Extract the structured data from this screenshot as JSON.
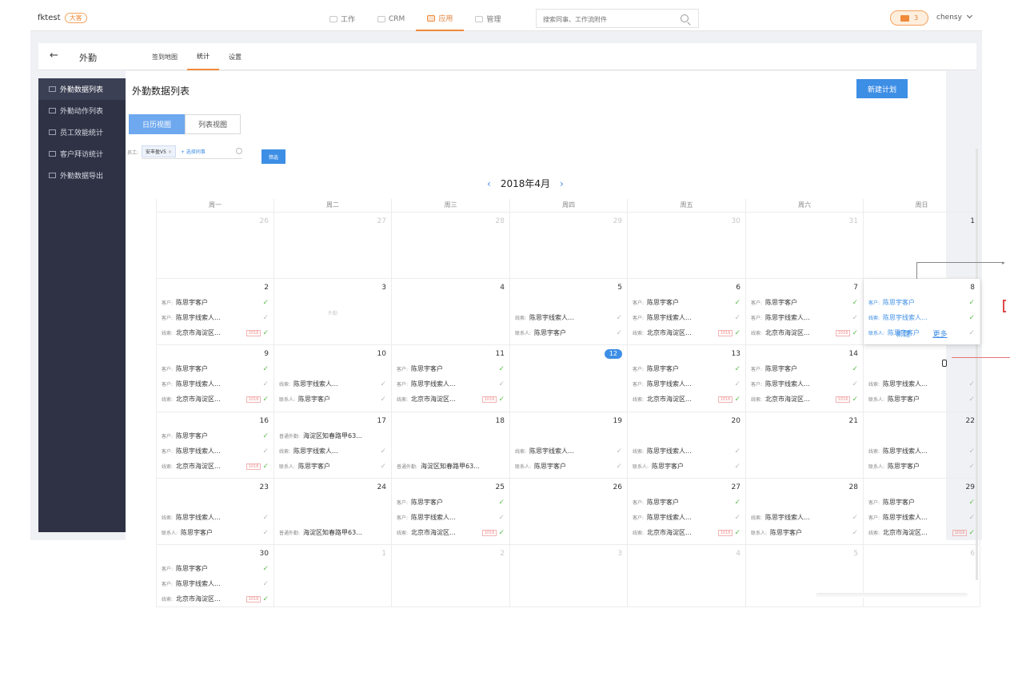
{
  "app": {
    "brand": "fktest",
    "brand_badge": "大客",
    "nav": [
      {
        "label": "工作",
        "active": false
      },
      {
        "label": "CRM",
        "active": false
      },
      {
        "label": "应用",
        "active": true
      },
      {
        "label": "管理",
        "active": false
      }
    ],
    "search_placeholder": "搜索同事、工作流附件",
    "message_count": "3",
    "user": "chensy"
  },
  "subbar": {
    "back_icon": "←",
    "title": "外勤",
    "tabs": [
      {
        "label": "签到地图",
        "active": false
      },
      {
        "label": "统计",
        "active": true
      },
      {
        "label": "设置",
        "active": false
      }
    ]
  },
  "sidebar": {
    "items": [
      {
        "label": "外勤数据列表",
        "active": true
      },
      {
        "label": "外勤动作列表",
        "active": false
      },
      {
        "label": "员工效能统计",
        "active": false
      },
      {
        "label": "客户拜访统计",
        "active": false
      },
      {
        "label": "外勤数据导出",
        "active": false
      }
    ]
  },
  "main": {
    "title": "外勤数据列表",
    "new_button": "新建计划",
    "view_tabs": [
      {
        "label": "日历视图",
        "active": true
      },
      {
        "label": "列表视图",
        "active": false
      }
    ],
    "filter_label": "员工:",
    "filter_chip": "安丰盈V5",
    "filter_chip_close": "×",
    "filter_add": "+ 选择同事",
    "filter_button": "筛选",
    "month": "2018年4月",
    "prev": "‹",
    "next": "›"
  },
  "colors": {
    "accent": "#f08a3a",
    "primary": "#3d8ee5",
    "sidebar": "#2f3245",
    "check": "#5cbd4c"
  },
  "calendar": {
    "weekdays": [
      "周一",
      "周二",
      "周三",
      "周四",
      "周五",
      "周六",
      "周日"
    ],
    "weeks": [
      {
        "height": 83,
        "days": [
          {
            "day": "26",
            "muted": true,
            "events": []
          },
          {
            "day": "27",
            "muted": true,
            "events": []
          },
          {
            "day": "28",
            "muted": true,
            "events": []
          },
          {
            "day": "29",
            "muted": true,
            "events": []
          },
          {
            "day": "30",
            "muted": true,
            "events": []
          },
          {
            "day": "31",
            "muted": true,
            "events": []
          },
          {
            "day": "1",
            "muted": false,
            "events": []
          }
        ]
      },
      {
        "height": 83,
        "days": [
          {
            "day": "2",
            "events": [
              {
                "label": "客户:",
                "text": "陈思宇客户",
                "done": true
              },
              {
                "label": "客户:",
                "text": "陈思宇线索人...",
                "done": false
              },
              {
                "label": "线索:",
                "text": "北京市海淀区...",
                "tag": "1016",
                "done": true
              }
            ]
          },
          {
            "day": "3",
            "events": [],
            "faint": "外勤"
          },
          {
            "day": "4",
            "events": []
          },
          {
            "day": "5",
            "pad": 1,
            "events": [
              {
                "label": "线索:",
                "text": "陈思宇线索人...",
                "done": false
              },
              {
                "label": "联系人:",
                "text": "陈思宇客户",
                "done": false
              }
            ]
          },
          {
            "day": "6",
            "events": [
              {
                "label": "客户:",
                "text": "陈思宇客户",
                "done": true
              },
              {
                "label": "客户:",
                "text": "陈思宇线索人...",
                "done": false
              },
              {
                "label": "线索:",
                "text": "北京市海淀区...",
                "tag": "1016",
                "done": true
              }
            ]
          },
          {
            "day": "7",
            "events": [
              {
                "label": "客户:",
                "text": "陈思宇客户",
                "done": true
              },
              {
                "label": "客户:",
                "text": "陈思宇线索人...",
                "done": false
              },
              {
                "label": "线索:",
                "text": "北京市海淀区...",
                "tag": "1016",
                "done": true
              }
            ]
          },
          {
            "day": "8",
            "popup": true,
            "events": [
              {
                "label": "客户:",
                "text": "陈思宇客户",
                "done": true,
                "blue": true
              },
              {
                "label": "线索:",
                "text": "陈思宇线索人...",
                "done": true,
                "blue": true
              },
              {
                "label": "联系人:",
                "text": "陈思宇客户",
                "done": false,
                "blue": true
              }
            ]
          }
        ]
      },
      {
        "height": 84,
        "days": [
          {
            "day": "9",
            "events": [
              {
                "label": "客户:",
                "text": "陈思宇客户",
                "done": true
              },
              {
                "label": "客户:",
                "text": "陈思宇线索人...",
                "done": false
              },
              {
                "label": "线索:",
                "text": "北京市海淀区...",
                "tag": "1016",
                "done": true
              }
            ]
          },
          {
            "day": "10",
            "pad": 1,
            "events": [
              {
                "label": "线索:",
                "text": "陈思宇线索人...",
                "done": false
              },
              {
                "label": "联系人:",
                "text": "陈思宇客户",
                "done": false
              }
            ]
          },
          {
            "day": "11",
            "events": [
              {
                "label": "客户:",
                "text": "陈思宇客户",
                "done": true
              },
              {
                "label": "客户:",
                "text": "陈思宇线索人...",
                "done": false
              },
              {
                "label": "线索:",
                "text": "北京市海淀区...",
                "tag": "1016",
                "done": true
              }
            ]
          },
          {
            "day": "12",
            "today": true,
            "events": []
          },
          {
            "day": "13",
            "events": [
              {
                "label": "客户:",
                "text": "陈思宇客户",
                "done": true
              },
              {
                "label": "客户:",
                "text": "陈思宇线索人...",
                "done": false
              },
              {
                "label": "线索:",
                "text": "北京市海淀区...",
                "tag": "1016",
                "done": true
              }
            ]
          },
          {
            "day": "14",
            "events": [
              {
                "label": "客户:",
                "text": "陈思宇客户",
                "done": true
              },
              {
                "label": "客户:",
                "text": "陈思宇线索人...",
                "done": false
              },
              {
                "label": "线索:",
                "text": "北京市海淀区...",
                "tag": "1016",
                "done": true
              }
            ]
          },
          {
            "day": "",
            "pad": 1,
            "events": [
              {
                "label": "线索:",
                "text": "陈思宇线索人...",
                "done": false
              },
              {
                "label": "联系人:",
                "text": "陈思宇客户",
                "done": false
              }
            ]
          }
        ]
      },
      {
        "height": 83,
        "days": [
          {
            "day": "16",
            "events": [
              {
                "label": "客户:",
                "text": "陈思宇客户",
                "done": true
              },
              {
                "label": "客户:",
                "text": "陈思宇线索人...",
                "done": false
              },
              {
                "label": "线索:",
                "text": "北京市海淀区...",
                "tag": "1016",
                "done": true
              }
            ]
          },
          {
            "day": "17",
            "events": [
              {
                "label": "普通外勤:",
                "text": "海淀区知春路甲63...",
                "done": null
              },
              {
                "label": "线索:",
                "text": "陈思宇线索人...",
                "done": false
              },
              {
                "label": "联系人:",
                "text": "陈思宇客户",
                "done": false
              }
            ]
          },
          {
            "day": "18",
            "pad": 2,
            "events": [
              {
                "label": "普通外勤:",
                "text": "海淀区知春路甲63...",
                "done": null
              }
            ]
          },
          {
            "day": "19",
            "pad": 1,
            "events": [
              {
                "label": "线索:",
                "text": "陈思宇线索人...",
                "done": false
              },
              {
                "label": "联系人:",
                "text": "陈思宇客户",
                "done": false
              }
            ]
          },
          {
            "day": "20",
            "pad": 1,
            "events": [
              {
                "label": "线索:",
                "text": "陈思宇线索人...",
                "done": false
              },
              {
                "label": "联系人:",
                "text": "陈思宇客户",
                "done": false
              }
            ]
          },
          {
            "day": "21",
            "events": []
          },
          {
            "day": "22",
            "pad": 1,
            "events": [
              {
                "label": "线索:",
                "text": "陈思宇线索人...",
                "done": false
              },
              {
                "label": "联系人:",
                "text": "陈思宇客户",
                "done": false
              }
            ]
          }
        ]
      },
      {
        "height": 83,
        "days": [
          {
            "day": "23",
            "pad": 1,
            "events": [
              {
                "label": "线索:",
                "text": "陈思宇线索人...",
                "done": false
              },
              {
                "label": "联系人:",
                "text": "陈思宇客户",
                "done": false
              }
            ]
          },
          {
            "day": "24",
            "pad": 2,
            "events": [
              {
                "label": "普通外勤:",
                "text": "海淀区知春路甲63...",
                "done": null
              }
            ]
          },
          {
            "day": "25",
            "events": [
              {
                "label": "客户:",
                "text": "陈思宇客户",
                "done": true
              },
              {
                "label": "客户:",
                "text": "陈思宇线索人...",
                "done": false
              },
              {
                "label": "线索:",
                "text": "北京市海淀区...",
                "tag": "1016",
                "done": true
              }
            ]
          },
          {
            "day": "26",
            "events": []
          },
          {
            "day": "27",
            "events": [
              {
                "label": "客户:",
                "text": "陈思宇客户",
                "done": true
              },
              {
                "label": "客户:",
                "text": "陈思宇线索人...",
                "done": false
              },
              {
                "label": "线索:",
                "text": "北京市海淀区...",
                "tag": "1016",
                "done": true
              }
            ]
          },
          {
            "day": "28",
            "pad": 1,
            "events": [
              {
                "label": "线索:",
                "text": "陈思宇线索人...",
                "done": false
              },
              {
                "label": "联系人:",
                "text": "陈思宇客户",
                "done": false
              }
            ]
          },
          {
            "day": "29",
            "events": [
              {
                "label": "客户:",
                "text": "陈思宇客户",
                "done": true
              },
              {
                "label": "客户:",
                "text": "陈思宇线索人...",
                "done": false
              },
              {
                "label": "线索:",
                "text": "北京市海淀区...",
                "tag": "1016",
                "done": true
              }
            ]
          }
        ]
      },
      {
        "height": 78,
        "days": [
          {
            "day": "30",
            "events": [
              {
                "label": "客户:",
                "text": "陈思宇客户",
                "done": true
              },
              {
                "label": "客户:",
                "text": "陈思宇线索人...",
                "done": false
              },
              {
                "label": "线索:",
                "text": "北京市海淀区...",
                "tag": "1016",
                "done": true
              }
            ]
          },
          {
            "day": "1",
            "muted": true,
            "events": []
          },
          {
            "day": "2",
            "muted": true,
            "events": []
          },
          {
            "day": "3",
            "muted": true,
            "events": []
          },
          {
            "day": "4",
            "muted": true,
            "events": []
          },
          {
            "day": "5",
            "muted": true,
            "events": []
          },
          {
            "day": "6",
            "muted": true,
            "events": []
          }
        ]
      }
    ],
    "popup_actions": {
      "new": "新建",
      "more": "更多"
    }
  }
}
